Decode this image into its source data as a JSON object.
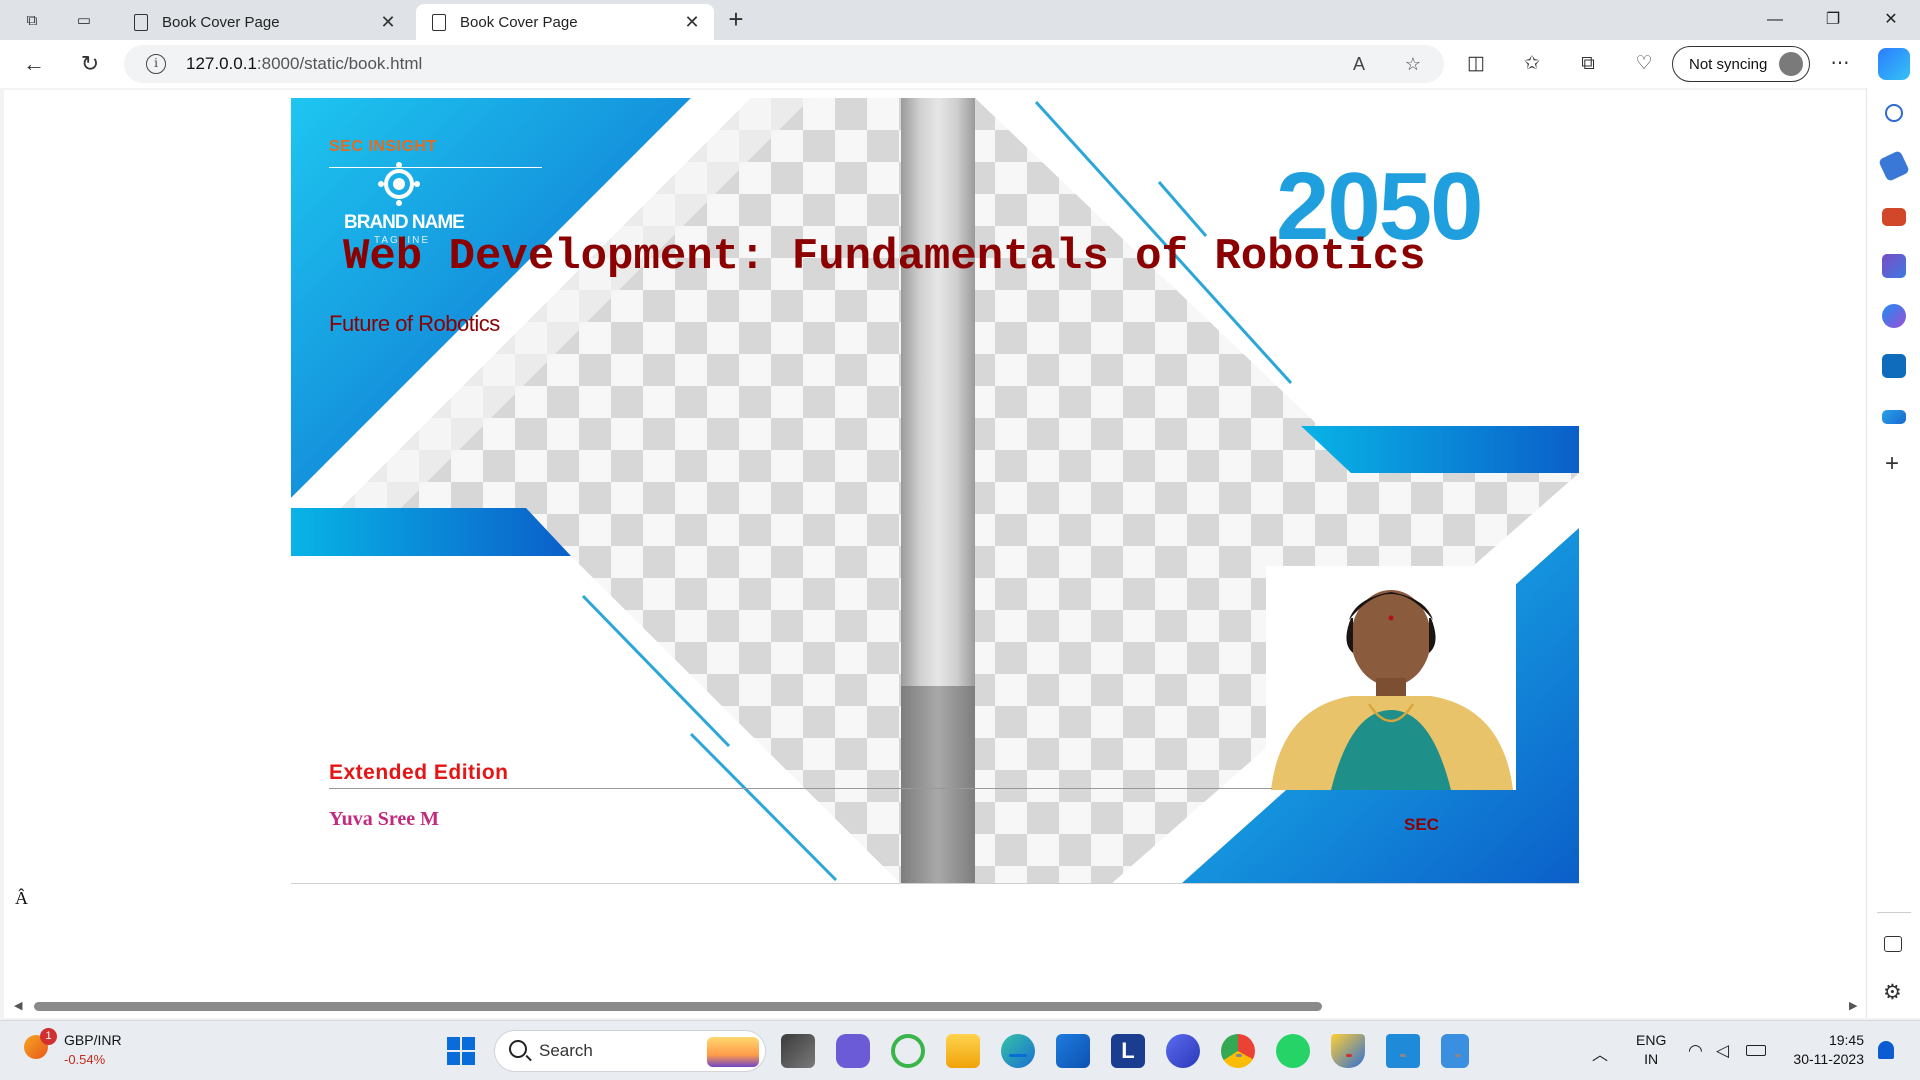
{
  "browser": {
    "tabs": [
      {
        "label": "Book Cover Page",
        "active": false
      },
      {
        "label": "Book Cover Page",
        "active": true
      }
    ],
    "address": {
      "host": "127.0.0.1",
      "path": ":8000/static/book.html"
    },
    "sync_label": "Not syncing"
  },
  "cover": {
    "sec_insight": "SEC INSIGHT",
    "brand_name": "BRAND NAME",
    "tagline": "TAGLINE",
    "year": "2050",
    "title": "Web Development: Fundamentals of Robotics",
    "subtitle": "Future of Robotics",
    "edition": "Extended Edition",
    "author": "Yuva Sree M",
    "institution": "SEC"
  },
  "page_stray_char": "Â",
  "taskbar": {
    "ticker_badge": "1",
    "ticker_name": "GBP/INR",
    "ticker_value": "-0.54%",
    "search_placeholder": "Search",
    "lang_line1": "ENG",
    "lang_line2": "IN",
    "time": "19:45",
    "date": "30-11-2023"
  },
  "colors": {
    "title": "#8b0000",
    "edition": "#e51515",
    "author": "#c22a7e",
    "year": "#1f9fde",
    "accent_blue": "#0a6cd8"
  }
}
